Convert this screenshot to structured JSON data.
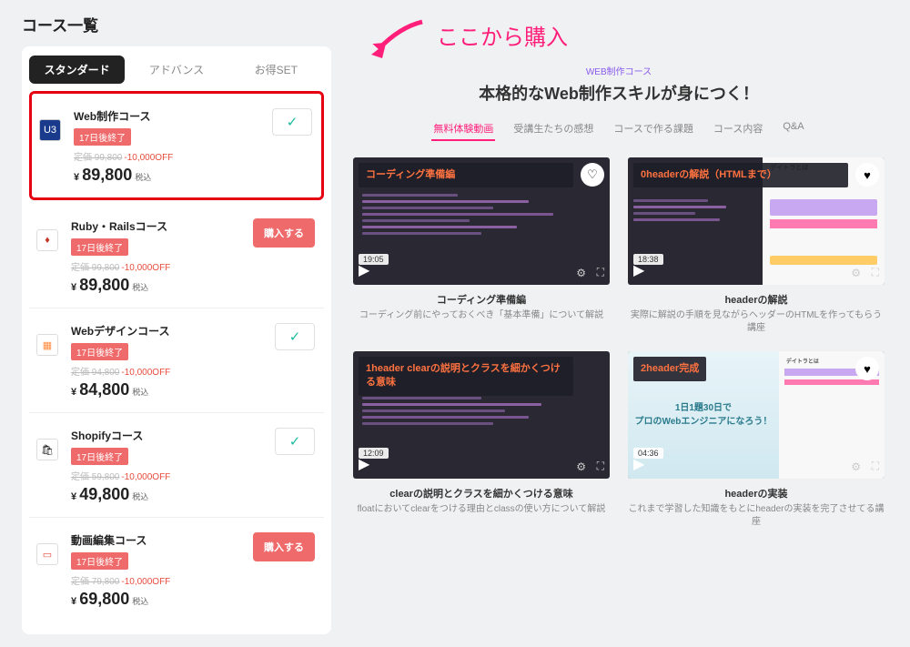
{
  "page_title": "コース一覧",
  "tabs": [
    "スタンダード",
    "アドバンス",
    "お得SET"
  ],
  "courses": [
    {
      "name": "Web制作コース",
      "badge": "17日後終了",
      "old": "定価 99,800",
      "disc": "-10,000OFF",
      "price": "89,800",
      "tax": "税込",
      "selected": true,
      "icon": "U3"
    },
    {
      "name": "Ruby・Railsコース",
      "badge": "17日後終了",
      "old": "定価 99,800",
      "disc": "-10,000OFF",
      "price": "89,800",
      "tax": "税込",
      "buy": "購入する",
      "icon": "♦"
    },
    {
      "name": "Webデザインコース",
      "badge": "17日後終了",
      "old": "定価 94,800",
      "disc": "-10,000OFF",
      "price": "84,800",
      "tax": "税込",
      "selected": true,
      "icon": "▦"
    },
    {
      "name": "Shopifyコース",
      "badge": "17日後終了",
      "old": "定価 59,800",
      "disc": "-10,000OFF",
      "price": "49,800",
      "tax": "税込",
      "selected": true,
      "icon": "🛍"
    },
    {
      "name": "動画編集コース",
      "badge": "17日後終了",
      "old": "定価 79,800",
      "disc": "-10,000OFF",
      "price": "69,800",
      "tax": "税込",
      "buy": "購入する",
      "icon": "▭"
    }
  ],
  "annotation": "ここから購入",
  "right": {
    "sub": "WEB制作コース",
    "title": "本格的なWeb制作スキルが身につく！",
    "nav": [
      "無料体験動画",
      "受講生たちの感想",
      "コースで作る課題",
      "コース内容",
      "Q&A"
    ]
  },
  "videos": [
    {
      "overlay": "コーディング準備編",
      "time": "19:05",
      "title": "コーディング準備編",
      "desc": "コーディング前にやっておくべき「基本準備」について解説",
      "type": "code"
    },
    {
      "overlay": "0headerの解説（HTMLまで）",
      "time": "18:38",
      "title": "headerの解説",
      "desc": "実際に解説の手順を見ながらヘッダーのHTMLを作ってもらう講座",
      "type": "split"
    },
    {
      "overlay": "1header clearの説明とクラスを細かくつける意味",
      "time": "12:09",
      "title": "clearの説明とクラスを細かくつける意味",
      "desc": "floatにおいてclearをつける理由とclassの使い方について解説",
      "type": "code"
    },
    {
      "overlay": "2header完成",
      "time": "04:36",
      "title": "headerの実装",
      "desc": "これまで学習した知識をもとにheaderの実装を完了させてる講座",
      "type": "engineer",
      "eng1": "1日1題30日で",
      "eng2": "プロのWebエンジニアになろう！"
    }
  ]
}
